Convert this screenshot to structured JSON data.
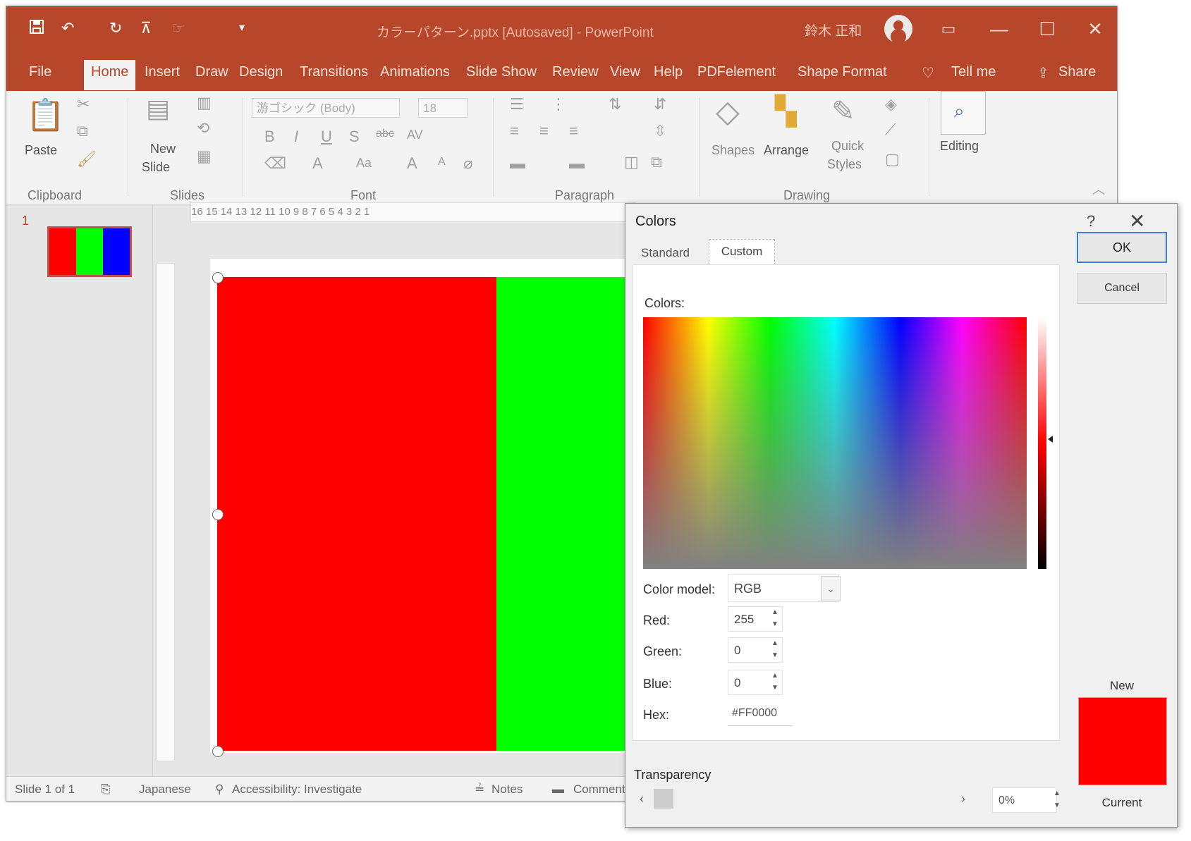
{
  "titlebar": {
    "document_title": "カラーパターン.pptx [Autosaved] - PowerPoint",
    "user_name": "鈴木 正和",
    "window_controls": [
      "ribbon-display-icon",
      "minimize-icon",
      "maximize-icon",
      "close-icon"
    ],
    "qat_icons": [
      "save-icon",
      "undo-icon",
      "redo-icon",
      "slideshow-icon",
      "customize-icon"
    ]
  },
  "tabs": [
    {
      "label": "File"
    },
    {
      "label": "Home"
    },
    {
      "label": "Insert"
    },
    {
      "label": "Draw"
    },
    {
      "label": "Design"
    },
    {
      "label": "Transitions"
    },
    {
      "label": "Animations"
    },
    {
      "label": "Slide Show"
    },
    {
      "label": "Review"
    },
    {
      "label": "View"
    },
    {
      "label": "Help"
    },
    {
      "label": "PDFelement"
    },
    {
      "label": "Shape Format"
    }
  ],
  "tell_me": "Tell me",
  "share": "Share",
  "ribbon": {
    "paste": "Paste",
    "new_slide_1": "New",
    "new_slide_2": "Slide",
    "font_name": "游ゴシック (Body)",
    "font_size": "18",
    "shapes": "Shapes",
    "arrange": "Arrange",
    "quick_styles_1": "Quick",
    "quick_styles_2": "Styles",
    "editing": "Editing",
    "groups": {
      "clipboard": "Clipboard",
      "slides": "Slides",
      "font": "Font",
      "paragraph": "Paragraph",
      "drawing": "Drawing"
    }
  },
  "slides_pane": {
    "slide_number": "1",
    "thumbnail_colors": [
      "#ff0000",
      "#00ff00",
      "#0000ff"
    ]
  },
  "ruler_text": "16 15 14 13 12 11 10 9 8 7 6 5 4 3 2 1",
  "status": {
    "slide_info": "Slide 1 of 1",
    "language": "Japanese",
    "accessibility": "Accessibility: Investigate",
    "notes": "Notes",
    "comments": "Comments"
  },
  "dialog": {
    "title": "Colors",
    "help": "?",
    "tabs": {
      "standard": "Standard",
      "custom": "Custom"
    },
    "colors_label": "Colors:",
    "color_model_label": "Color model:",
    "color_model_value": "RGB",
    "red_label": "Red:",
    "red_value": "255",
    "green_label": "Green:",
    "green_value": "0",
    "blue_label": "Blue:",
    "blue_value": "0",
    "hex_label": "Hex:",
    "hex_value": "#FF0000",
    "transparency_label": "Transparency",
    "transparency_value": "0%",
    "ok": "OK",
    "cancel": "Cancel",
    "new_label": "New",
    "current_label": "Current",
    "new_color": "#ff0000",
    "current_color": "#ff0000"
  },
  "colors": {
    "accent": "#b7472a",
    "shape_red": "#ff0000",
    "shape_green": "#00ff00"
  }
}
